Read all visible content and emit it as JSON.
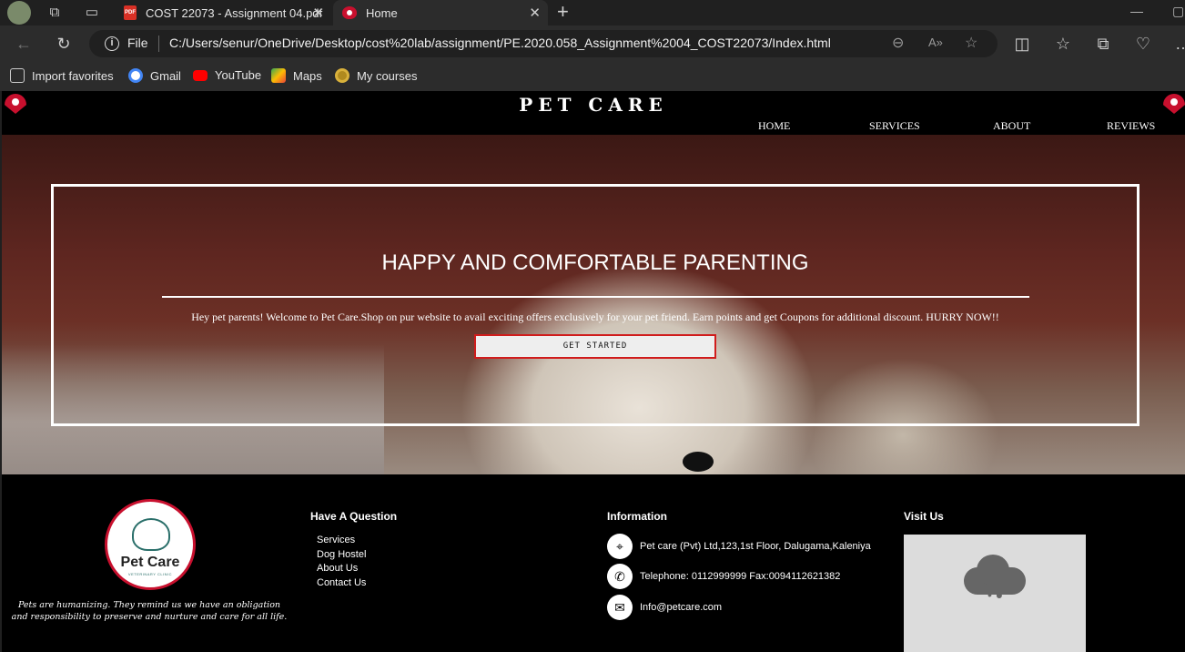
{
  "browser": {
    "tabs": [
      {
        "title": "COST 22073 - Assignment 04.pdf",
        "icon": "pdf-icon"
      },
      {
        "title": "Home",
        "icon": "paw-heart-icon"
      }
    ],
    "address": {
      "scheme": "File",
      "url": "C:/Users/senur/OneDrive/Desktop/cost%20lab/assignment/PE.2020.058_Assignment%2004_COST22073/Index.html"
    },
    "favorites": [
      "Import favorites",
      "Gmail",
      "YouTube",
      "Maps",
      "My courses"
    ]
  },
  "site": {
    "title": "PET CARE",
    "nav": [
      "HOME",
      "SERVICES",
      "ABOUT",
      "REVIEWS"
    ],
    "hero": {
      "heading": "HAPPY AND COMFORTABLE PARENTING",
      "text": "Hey pet parents! Welcome to Pet Care.Shop on pur website to avail exciting offers exclusively for your pet friend. Earn points and get Coupons for additional discount. HURRY NOW!!",
      "cta": "GET STARTED"
    },
    "footer": {
      "logo_name": "Pet Care",
      "logo_sub": "VETERINARY CLINIC",
      "quote": "Pets are humanizing. They remind us we have an obligation and responsibility to preserve and nurture and care for all life.",
      "question_heading": "Have A Question",
      "links": [
        "Services",
        "Dog Hostel",
        "About Us",
        "Contact Us"
      ],
      "info_heading": "Information",
      "address": "Pet care (Pvt) Ltd,123,1st Floor, Dalugama,Kaleniya",
      "phone": "Telephone: 0112999999 Fax:0094112621382",
      "email": "Info@petcare.com",
      "visit_heading": "Visit Us"
    }
  },
  "colors": {
    "accent_red": "#c8102e",
    "cta_border": "#d01c1c",
    "chrome_dark": "#202020",
    "chrome_bar": "#2c2c2c"
  }
}
